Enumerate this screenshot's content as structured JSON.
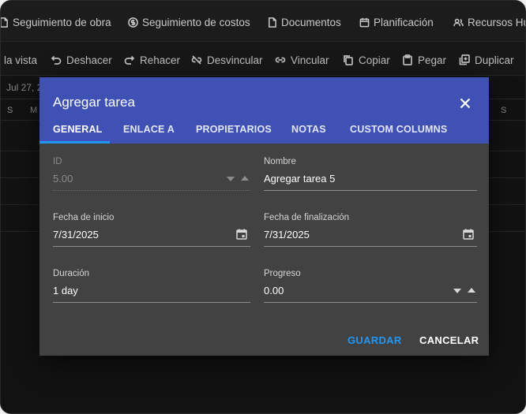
{
  "nav": {
    "items": [
      {
        "label": "Seguimiento de obra",
        "icon": "document-icon"
      },
      {
        "label": "Seguimiento de costos",
        "icon": "dollar-icon"
      },
      {
        "label": "Documentos",
        "icon": "file-icon"
      },
      {
        "label": "Planificación",
        "icon": "calendar-icon"
      },
      {
        "label": "Recursos Hu",
        "icon": "people-icon"
      }
    ]
  },
  "toolbar": {
    "items": [
      {
        "label": "la vista",
        "icon": ""
      },
      {
        "label": "Deshacer",
        "icon": "undo-icon"
      },
      {
        "label": "Rehacer",
        "icon": "redo-icon"
      },
      {
        "label": "Desvincular",
        "icon": "unlink-icon"
      },
      {
        "label": "Vincular",
        "icon": "link-icon"
      },
      {
        "label": "Copiar",
        "icon": "copy-icon"
      },
      {
        "label": "Pegar",
        "icon": "paste-icon"
      },
      {
        "label": "Duplicar",
        "icon": "duplicate-icon"
      }
    ]
  },
  "gantt": {
    "date": "Jul 27, 2",
    "days": [
      "S",
      "M",
      "S"
    ]
  },
  "dialog": {
    "title": "Agregar tarea",
    "tabs": [
      "GENERAL",
      "ENLACE A",
      "PROPIETARIOS",
      "NOTAS",
      "CUSTOM COLUMNS"
    ],
    "active_tab": "GENERAL",
    "fields": {
      "id": {
        "label": "ID",
        "value": "5.00"
      },
      "name": {
        "label": "Nombre",
        "value": "Agregar tarea 5"
      },
      "start": {
        "label": "Fecha de inicio",
        "value": "7/31/2025"
      },
      "end": {
        "label": "Fecha de finalización",
        "value": "7/31/2025"
      },
      "duration": {
        "label": "Duración",
        "value": "1 day"
      },
      "progress": {
        "label": "Progreso",
        "value": "0.00"
      }
    },
    "save_label": "GUARDAR",
    "cancel_label": "CANCELAR"
  },
  "colors": {
    "header": "#3f51b5",
    "dialog_bg": "#424242",
    "accent": "#2196f3"
  }
}
